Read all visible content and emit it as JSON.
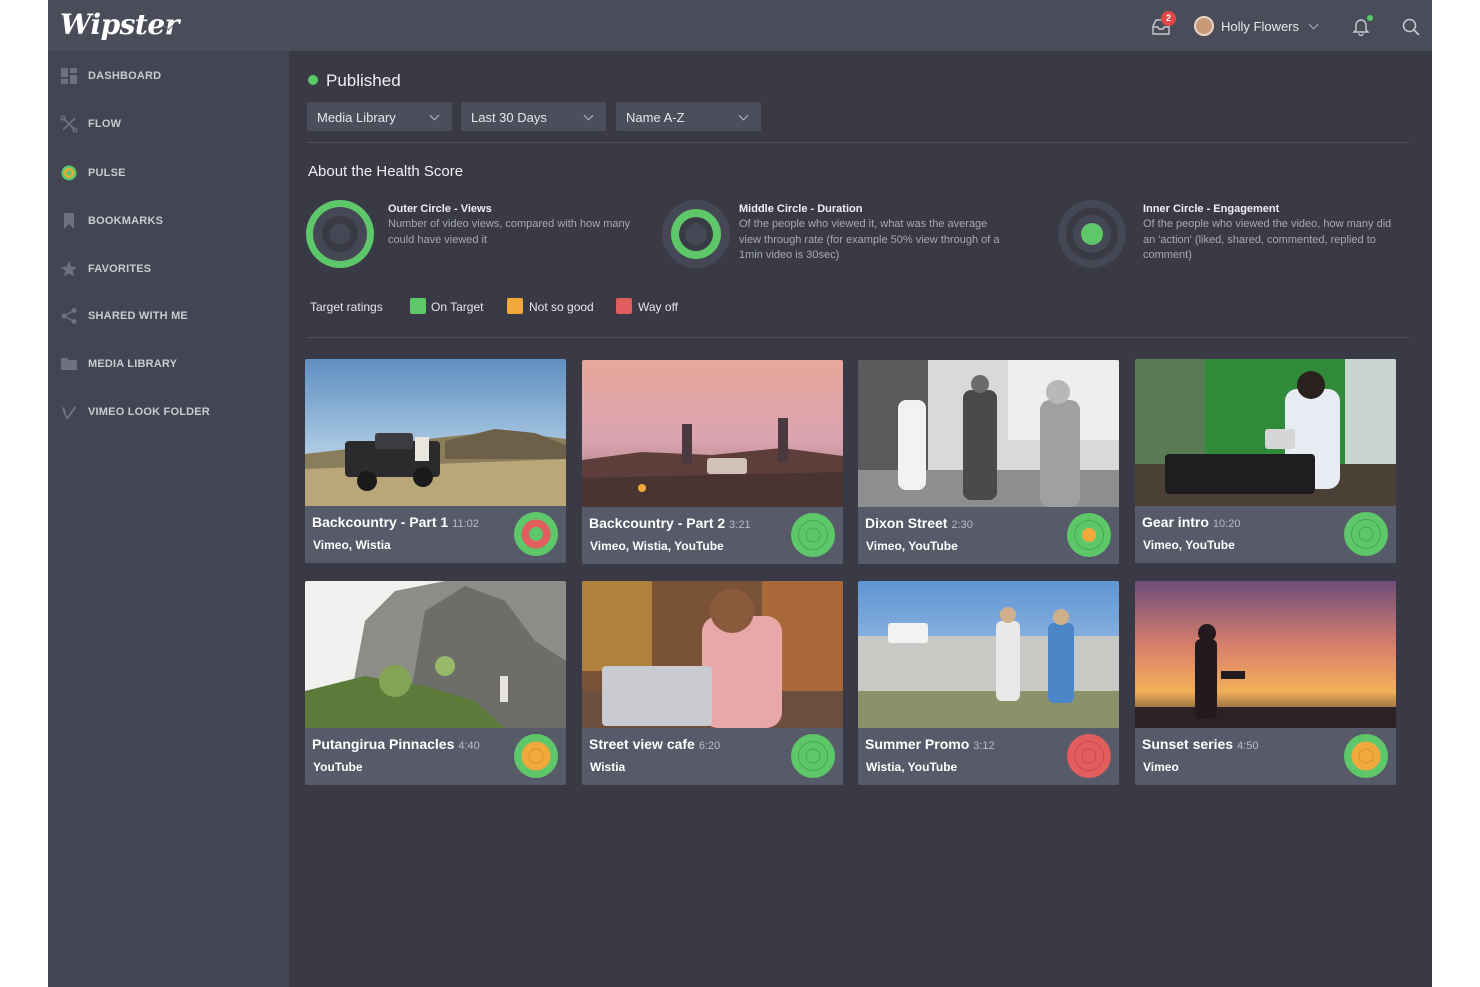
{
  "app": {
    "logo": "Wipster"
  },
  "topbar": {
    "notification_count": "2",
    "user_name": "Holly Flowers"
  },
  "sidebar": {
    "items": [
      {
        "label": "DASHBOARD",
        "icon": "dashboard-icon"
      },
      {
        "label": "FLOW",
        "icon": "flow-icon"
      },
      {
        "label": "PULSE",
        "icon": "pulse-icon"
      },
      {
        "label": "BOOKMARKS",
        "icon": "bookmark-icon"
      },
      {
        "label": "FAVORITES",
        "icon": "star-icon"
      },
      {
        "label": "SHARED WITH ME",
        "icon": "share-icon"
      },
      {
        "label": "MEDIA LIBRARY",
        "icon": "folder-icon"
      },
      {
        "label": "VIMEO LOOK FOLDER",
        "icon": "vimeo-icon"
      }
    ]
  },
  "main": {
    "status": "Published",
    "filters": [
      {
        "value": "Media Library"
      },
      {
        "value": "Last 30 Days"
      },
      {
        "value": "Name A-Z"
      }
    ],
    "about_title": "About the Health Score",
    "health_items": [
      {
        "title": "Outer Circle - Views",
        "description": "Number of video views, compared with how many could have viewed it"
      },
      {
        "title": "Middle Circle - Duration",
        "description": "Of the people who viewed it, what was the average view through rate (for example 50% view through of a 1min video is 30sec)"
      },
      {
        "title": "Inner Circle - Engagement",
        "description": "Of the people who viewed the video, how many did an 'action' (liked, shared, commented, replied to comment)"
      }
    ],
    "target_ratings": {
      "label": "Target ratings",
      "items": [
        {
          "label": "On Target",
          "color": "#5ec76a"
        },
        {
          "label": "Not so good",
          "color": "#f2a93b"
        },
        {
          "label": "Way off",
          "color": "#e25d5d"
        }
      ]
    },
    "videos": [
      {
        "title": "Backcountry - Part 1",
        "duration": "11:02",
        "platforms": "Vimeo, Wistia",
        "scores": [
          "#5ec76a",
          "#e25d5d",
          "#5ec76a"
        ]
      },
      {
        "title": "Backcountry - Part 2",
        "duration": "3:21",
        "platforms": "Vimeo, Wistia, YouTube",
        "scores": [
          "#5ec76a",
          "#5ec76a",
          "#5ec76a"
        ]
      },
      {
        "title": "Dixon Street",
        "duration": "2:30",
        "platforms": "Vimeo, YouTube",
        "scores": [
          "#5ec76a",
          "#5ec76a",
          "#f2a93b"
        ]
      },
      {
        "title": "Gear intro",
        "duration": "10:20",
        "platforms": "Vimeo, YouTube",
        "scores": [
          "#5ec76a",
          "#5ec76a",
          "#5ec76a"
        ]
      },
      {
        "title": "Putangirua Pinnacles",
        "duration": "4:40",
        "platforms": "YouTube",
        "scores": [
          "#5ec76a",
          "#f2a93b",
          "#f2a93b"
        ]
      },
      {
        "title": "Street view cafe",
        "duration": "6:20",
        "platforms": "Wistia",
        "scores": [
          "#5ec76a",
          "#5ec76a",
          "#5ec76a"
        ]
      },
      {
        "title": "Summer Promo",
        "duration": "3:12",
        "platforms": "Wistia, YouTube",
        "scores": [
          "#e25d5d",
          "#e25d5d",
          "#e25d5d"
        ]
      },
      {
        "title": "Sunset series",
        "duration": "4:50",
        "platforms": "Vimeo",
        "scores": [
          "#5ec76a",
          "#f2a93b",
          "#f2a93b"
        ]
      }
    ]
  }
}
